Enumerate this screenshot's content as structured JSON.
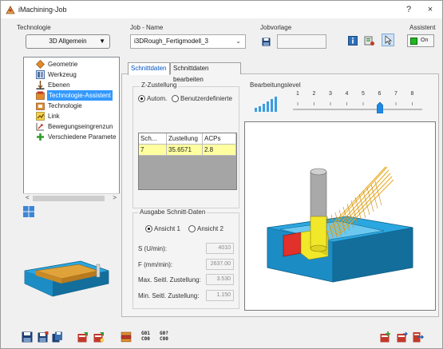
{
  "window": {
    "title": "iMachining-Job",
    "help_label": "?",
    "close_label": "×"
  },
  "header": {
    "technology_label": "Technologie",
    "technology_value": "3D Allgemein",
    "job_name_label": "Job - Name",
    "job_name_value": "i3DRough_Fertigmodell_3",
    "template_label": "Jobvorlage",
    "template_value": "",
    "assistant_label": "Assistent",
    "assistant_toggle": "On"
  },
  "tree": {
    "items": [
      {
        "label": "Geometrie",
        "icon": "geometry-icon",
        "selected": false
      },
      {
        "label": "Werkzeug",
        "icon": "tool-icon",
        "selected": false
      },
      {
        "label": "Ebenen",
        "icon": "levels-icon",
        "selected": false
      },
      {
        "label": "Technologie-Assistent",
        "icon": "tech-assistant-icon",
        "selected": true
      },
      {
        "label": "Technologie",
        "icon": "technology-icon",
        "selected": false
      },
      {
        "label": "Link",
        "icon": "link-icon",
        "selected": false
      },
      {
        "label": "Bewegungseingrenzun",
        "icon": "motion-limit-icon",
        "selected": false
      },
      {
        "label": "Verschiedene Paramete",
        "icon": "misc-params-icon",
        "selected": false
      }
    ],
    "scroll_left": "<",
    "scroll_right": ">"
  },
  "tabs": [
    {
      "label": "Schnittdaten",
      "active": true
    },
    {
      "label": "Schnittdaten bearbeiten",
      "active": false
    }
  ],
  "z_feed": {
    "label": "Z-Zustellung",
    "option_auto": "Autom.",
    "option_user": "Benutzerdefinierte",
    "selected": "auto"
  },
  "level": {
    "label": "Bearbeitungslevel",
    "ticks": [
      "1",
      "2",
      "3",
      "4",
      "5",
      "6",
      "7",
      "8"
    ],
    "value": 6
  },
  "cut_table": {
    "columns": [
      "Sch...",
      "Zustellung",
      "ACPs"
    ],
    "rows": [
      [
        "7",
        "35.6571",
        "2.8"
      ]
    ]
  },
  "output": {
    "label": "Ausgabe Schnitt-Daten",
    "view1": "Ansicht 1",
    "view2": "Ansicht 2",
    "selected": "view1",
    "fields": [
      {
        "label": "S (U/min):",
        "value": "4010"
      },
      {
        "label": "F (mm/min):",
        "value": "2637.00"
      },
      {
        "label": "Max. Seitl. Zustellung:",
        "value": "3.530"
      },
      {
        "label": "Min. Seitl. Zustellung:",
        "value": "1.150"
      }
    ]
  },
  "toolbar_bottom": {
    "gcode_1": "G01\nC00",
    "gcode_2": "G0?\nC00"
  },
  "colors": {
    "accent_blue": "#3399ff",
    "highlight_yellow": "#ffffa0",
    "part_cyan": "#2aa7e0",
    "slider_blue": "#1e88e5"
  }
}
